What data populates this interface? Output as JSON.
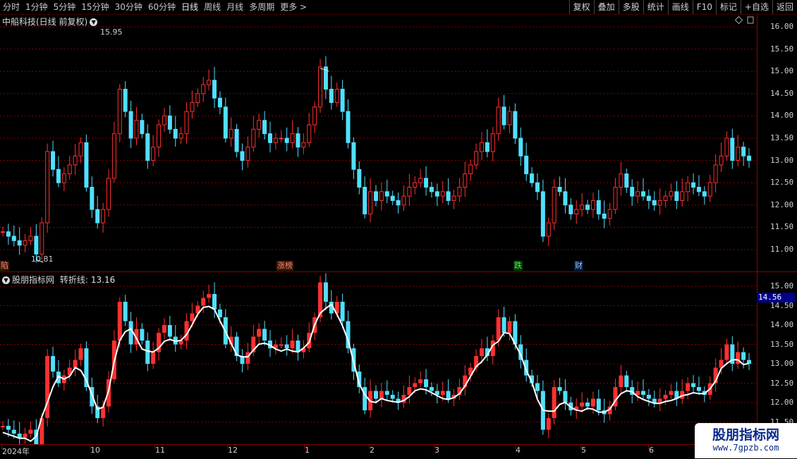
{
  "toolbar": {
    "periods": [
      "分时",
      "1分钟",
      "5分钟",
      "15分钟",
      "30分钟",
      "60分钟",
      "日线",
      "周线",
      "月线",
      "多周期",
      "更多 >"
    ],
    "active_period": "日线",
    "tools": [
      "复权",
      "叠加",
      "多股",
      "统计",
      "画线",
      "F10",
      "标记",
      "+自选",
      "返回"
    ]
  },
  "stock": {
    "title": "中船科技(日线 前复权)",
    "high_label": "15.95",
    "low_label": "10.81"
  },
  "indicator": {
    "name": "股朋指标网",
    "line_label": "转折线:",
    "line_value": "13.16",
    "current_price": "14.56"
  },
  "price_axis": [
    "16.00",
    "15.50",
    "15.00",
    "14.50",
    "14.00",
    "13.50",
    "13.00",
    "12.50",
    "12.00",
    "11.50",
    "11.00"
  ],
  "indicator_axis": [
    "15.00",
    "14.50",
    "14.00",
    "13.50",
    "13.00",
    "12.50",
    "12.00",
    "11.50"
  ],
  "date_axis": [
    "2024年",
    "10",
    "11",
    "12",
    "1",
    "2",
    "3",
    "4",
    "5",
    "6"
  ],
  "events": [
    "陷",
    "涨榜",
    "跌",
    "财"
  ],
  "watermark": {
    "title": "股朋指标网",
    "url": "www.7gpzb.com"
  },
  "colors": {
    "up": "#ff3030",
    "down": "#50e0ff",
    "line": "#ffffff",
    "grid": "#8a0000",
    "background": "#000000"
  },
  "chart_data": {
    "type": "candlestick",
    "ylim": [
      10.6,
      16.25
    ],
    "closes": [
      11.4,
      11.3,
      11.2,
      11.1,
      11.2,
      11.3,
      10.9,
      11.6,
      13.2,
      12.8,
      12.5,
      12.7,
      12.9,
      13.1,
      13.4,
      12.4,
      11.9,
      11.6,
      11.9,
      12.6,
      13.6,
      14.6,
      14.1,
      13.5,
      13.9,
      13.6,
      13.0,
      13.3,
      13.8,
      14.0,
      13.7,
      13.5,
      13.6,
      14.1,
      14.3,
      14.5,
      14.7,
      14.8,
      14.4,
      14.2,
      13.5,
      13.7,
      13.2,
      13.0,
      13.3,
      13.7,
      13.9,
      13.6,
      13.4,
      13.5,
      13.5,
      13.4,
      13.6,
      13.3,
      13.4,
      13.8,
      14.2,
      15.1,
      14.6,
      14.3,
      14.6,
      14.1,
      13.4,
      12.8,
      12.4,
      11.8,
      12.3,
      12.1,
      12.3,
      12.2,
      12.1,
      12.0,
      12.2,
      12.4,
      12.5,
      12.6,
      12.4,
      12.3,
      12.2,
      12.3,
      12.1,
      12.2,
      12.4,
      12.7,
      12.9,
      13.2,
      13.4,
      13.2,
      13.6,
      14.2,
      13.8,
      14.1,
      13.5,
      13.1,
      12.7,
      12.5,
      12.3,
      11.3,
      11.6,
      12.4,
      12.3,
      12.0,
      11.8,
      11.9,
      12.0,
      11.9,
      12.1,
      11.8,
      11.7,
      11.9,
      12.4,
      12.7,
      12.4,
      12.2,
      12.3,
      12.2,
      12.1,
      12.0,
      12.1,
      12.2,
      12.3,
      12.1,
      12.3,
      12.5,
      12.4,
      12.3,
      12.2,
      12.5,
      12.9,
      13.1,
      13.5,
      13.0,
      13.3,
      13.1,
      13.0
    ]
  }
}
